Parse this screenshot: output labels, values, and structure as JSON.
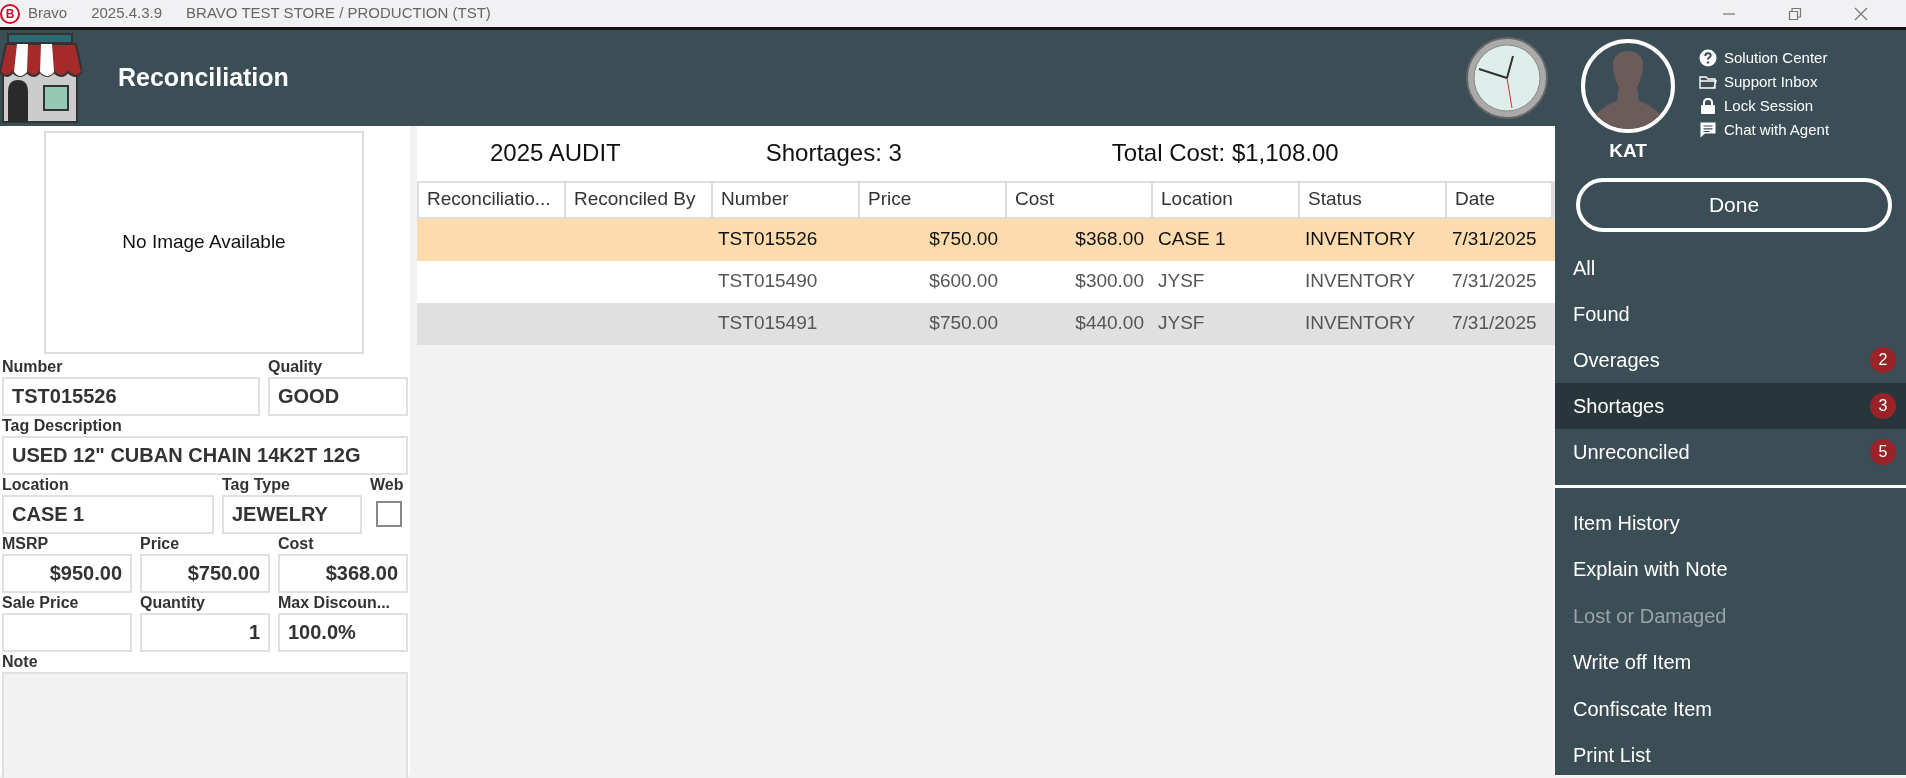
{
  "titlebar": {
    "logo_letter": "B",
    "app": "Bravo",
    "version": "2025.4.3.9",
    "store": "BRAVO TEST STORE / PRODUCTION (TST)"
  },
  "header": {
    "title": "Reconciliation"
  },
  "item": {
    "image_text": "No Image Available",
    "rows": [
      [
        {
          "label": "Number",
          "value": "TST015526",
          "kind": "text"
        },
        {
          "label": "Quality",
          "value": "GOOD",
          "kind": "text"
        }
      ],
      [
        {
          "label": "Tag Description",
          "value": "USED 12\" CUBAN CHAIN 14K2T 12G",
          "kind": "text"
        }
      ],
      [
        {
          "label": "Location",
          "value": "CASE 1",
          "kind": "text"
        },
        {
          "label": "Tag Type",
          "value": "JEWELRY",
          "kind": "text"
        },
        {
          "label": "Web",
          "kind": "checkbox",
          "checked": false
        }
      ],
      [
        {
          "label": "MSRP",
          "value": "$950.00",
          "kind": "number"
        },
        {
          "label": "Price",
          "value": "$750.00",
          "kind": "number"
        },
        {
          "label": "Cost",
          "value": "$368.00",
          "kind": "number"
        }
      ],
      [
        {
          "label": "Sale Price",
          "kind": "number"
        },
        {
          "label": "Quantity",
          "value": "1",
          "kind": "number"
        },
        {
          "label": "Max Discoun...",
          "value": "100.0%",
          "kind": "text"
        }
      ],
      [
        {
          "label": "Note",
          "kind": "textarea"
        }
      ]
    ]
  },
  "summary": {
    "audit": "2025 AUDIT",
    "shortages": "Shortages: 3",
    "total_cost": "Total Cost: $1,108.00"
  },
  "table": {
    "columns": [
      {
        "label": "Reconciliatio...",
        "kind": "text"
      },
      {
        "label": "Reconciled By",
        "kind": "text"
      },
      {
        "label": "Number",
        "kind": "text"
      },
      {
        "label": "Price",
        "kind": "money"
      },
      {
        "label": "Cost",
        "kind": "money"
      },
      {
        "label": "Location",
        "kind": "text"
      },
      {
        "label": "Status",
        "kind": "text"
      },
      {
        "label": "Date",
        "kind": "text"
      }
    ],
    "rows": [
      {
        "selected": true,
        "cells": [
          "",
          "",
          "TST015526",
          "$750.00",
          "$368.00",
          "CASE 1",
          "INVENTORY",
          "7/31/2025"
        ]
      },
      {
        "selected": false,
        "cells": [
          "",
          "",
          "TST015490",
          "$600.00",
          "$300.00",
          "JYSF",
          "INVENTORY",
          "7/31/2025"
        ]
      },
      {
        "selected": false,
        "cells": [
          "",
          "",
          "TST015491",
          "$750.00",
          "$440.00",
          "JYSF",
          "INVENTORY",
          "7/31/2025"
        ]
      }
    ]
  },
  "user": {
    "name": "KAT",
    "links": [
      {
        "label": "Solution Center",
        "kind": "help"
      },
      {
        "label": "Support Inbox",
        "kind": "folder"
      },
      {
        "label": "Lock Session",
        "kind": "lock"
      },
      {
        "label": "Chat with Agent",
        "kind": "chat"
      }
    ]
  },
  "done_button": "Done",
  "filters": [
    {
      "label": "All",
      "selected": false
    },
    {
      "label": "Found",
      "selected": false
    },
    {
      "label": "Overages",
      "selected": false,
      "count": "2"
    },
    {
      "label": "Shortages",
      "selected": true,
      "count": "3"
    },
    {
      "label": "Unreconciled",
      "selected": false,
      "count": "5"
    }
  ],
  "actions": [
    {
      "label": "Item History",
      "disabled": false
    },
    {
      "label": "Explain with Note",
      "disabled": false
    },
    {
      "label": "Lost or Damaged",
      "disabled": true
    },
    {
      "label": "Write off Item",
      "disabled": false
    },
    {
      "label": "Confiscate Item",
      "disabled": false
    },
    {
      "label": "Print List",
      "disabled": false
    }
  ]
}
